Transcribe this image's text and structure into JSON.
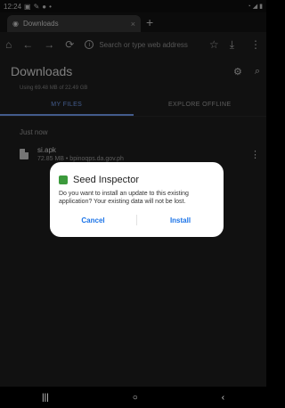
{
  "status_bar": {
    "time": "12:24",
    "left_icons": [
      "gallery-icon",
      "edit-icon",
      "record-icon",
      "dot-icon"
    ],
    "right_icons": [
      "wifi-icon",
      "signal-icon",
      "battery-icon"
    ]
  },
  "browser": {
    "tab_title": "Downloads",
    "tab_close": "×",
    "new_tab": "+",
    "omnibox_placeholder": "Search or type web address"
  },
  "downloads": {
    "title": "Downloads",
    "storage": "Using 69.48 MB of 22.49 GB",
    "tabs": [
      "MY FILES",
      "EXPLORE OFFLINE"
    ],
    "section": "Just now",
    "items": [
      {
        "name": "si.apk",
        "meta": "72.85 MB • bpinoqps.da.gov.ph"
      }
    ]
  },
  "dialog": {
    "app_name": "Seed Inspector",
    "message": "Do you want to install an update to this existing application? Your existing data will not be lost.",
    "cancel": "Cancel",
    "install": "Install"
  },
  "nav": {
    "recents": "|||",
    "home": "○",
    "back": "‹"
  }
}
